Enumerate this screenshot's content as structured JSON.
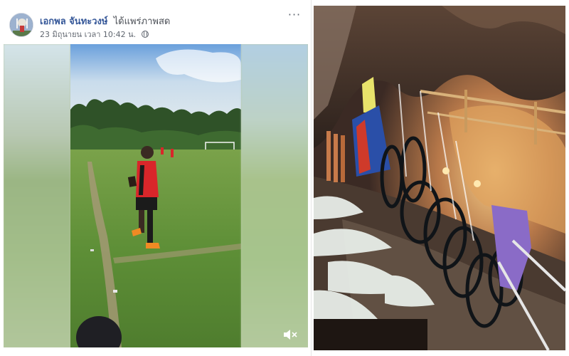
{
  "post": {
    "author_name": "เอกพล จันทะวงษ์",
    "action_text": "ได้แพร่ภาพสด",
    "timestamp": "23 มิถุนายน เวลา 10:42 น.",
    "privacy_icon": "globe-icon",
    "more_icon": "more-options-icon",
    "more_label": "···",
    "mute_icon": "volume-muted-icon"
  },
  "colors": {
    "author_link": "#365899",
    "meta_text": "#616770",
    "grass": "#5f8f3d",
    "jersey": "#d9262a"
  }
}
